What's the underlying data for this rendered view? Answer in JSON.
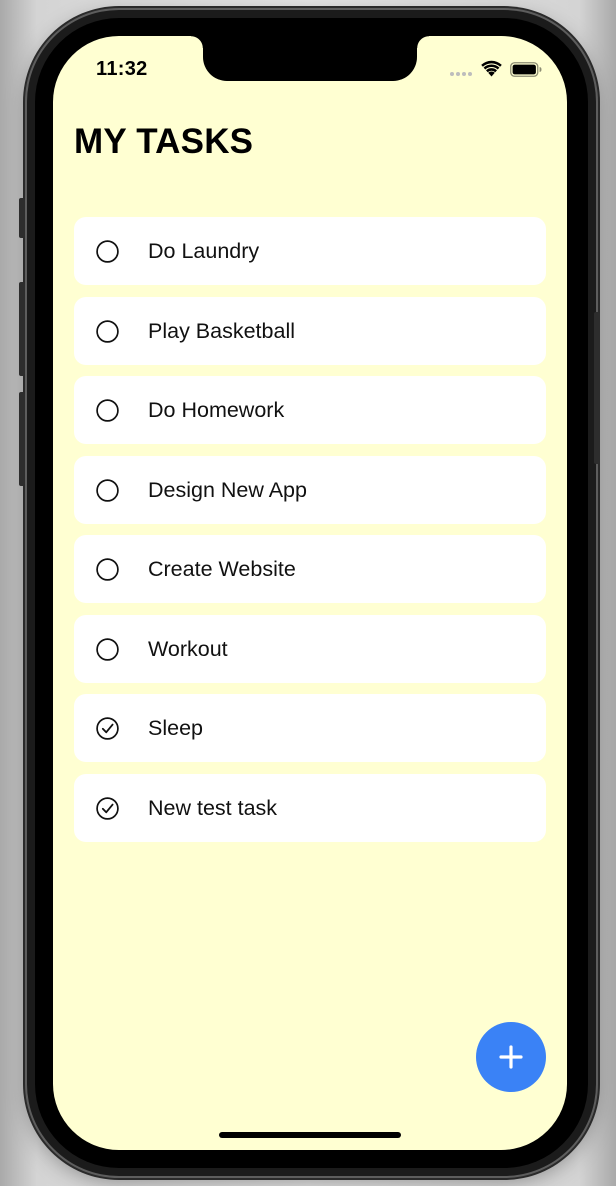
{
  "status_bar": {
    "time": "11:32",
    "icons": [
      "cellular-signal-icon",
      "wifi-icon",
      "battery-icon"
    ]
  },
  "header": {
    "title": "MY TASKS"
  },
  "tasks": [
    {
      "label": "Do Laundry",
      "completed": false
    },
    {
      "label": "Play Basketball",
      "completed": false
    },
    {
      "label": "Do Homework",
      "completed": false
    },
    {
      "label": "Design New App",
      "completed": false
    },
    {
      "label": "Create Website",
      "completed": false
    },
    {
      "label": "Workout",
      "completed": false
    },
    {
      "label": "Sleep",
      "completed": true
    },
    {
      "label": "New test task",
      "completed": true
    }
  ],
  "add_button": {
    "icon": "plus-icon"
  },
  "colors": {
    "background": "#ffffd2",
    "card": "#ffffff",
    "accent": "#3a82f6",
    "text": "#111111"
  }
}
